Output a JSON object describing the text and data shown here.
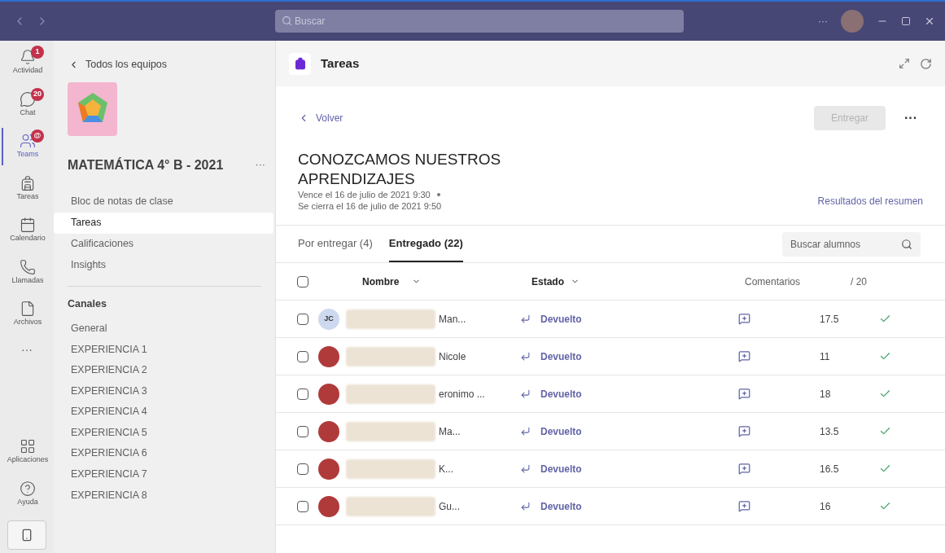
{
  "title_bar": {
    "search_placeholder": "Buscar",
    "more": "···"
  },
  "rail": [
    {
      "label": "Actividad",
      "kind": "bell",
      "badge": "1",
      "selected": false
    },
    {
      "label": "Chat",
      "kind": "chat",
      "badge": "20",
      "selected": false
    },
    {
      "label": "Teams",
      "kind": "teams",
      "badge": "@",
      "selected": true
    },
    {
      "label": "Tareas",
      "kind": "bag",
      "selected": false
    },
    {
      "label": "Calendario",
      "kind": "calendar",
      "selected": false
    },
    {
      "label": "Llamadas",
      "kind": "phone",
      "selected": false
    },
    {
      "label": "Archivos",
      "kind": "file",
      "selected": false
    }
  ],
  "rail_more": "···",
  "rail_bottom": [
    {
      "label": "Aplicaciones",
      "kind": "apps",
      "selected": false
    },
    {
      "label": "Ayuda",
      "kind": "help",
      "selected": false
    }
  ],
  "team_panel": {
    "back": "Todos los equipos",
    "team_name": "MATEMÁTICA 4° B - 2021",
    "more": "···",
    "nav": [
      {
        "label": "Bloc de notas de clase",
        "selected": false
      },
      {
        "label": "Tareas",
        "selected": true
      },
      {
        "label": "Calificaciones",
        "selected": false
      },
      {
        "label": "Insights",
        "selected": false
      }
    ],
    "channels_heading": "Canales",
    "channels": [
      "General",
      "EXPERIENCIA 1",
      "EXPERIENCIA 2",
      "EXPERIENCIA 3",
      "EXPERIENCIA 4",
      "EXPERIENCIA 5",
      "EXPERIENCIA 6",
      "EXPERIENCIA 7",
      "EXPERIENCIA 8"
    ]
  },
  "app_header": {
    "title": "Tareas"
  },
  "assignment": {
    "back": "Volver",
    "submit": {
      "label": "Entregar",
      "disabled": true
    },
    "more": "···",
    "title": "CONOZCAMOS NUESTROS APRENDIZAJES",
    "due": "Vence el 16 de julio de 2021 9:30",
    "closes": "Se cierra el 16 de julio de 2021 9:50",
    "summary_link": "Resultados del resumen"
  },
  "tabs": [
    {
      "label": "Por entregar (4)",
      "selected": false
    },
    {
      "label": "Entregado (22)",
      "selected": true
    }
  ],
  "student_search": {
    "placeholder": "Buscar alumnos"
  },
  "table": {
    "select_all_checked": false,
    "columns": [
      "Nombre",
      "Estado",
      "Comentarios",
      "/ 20"
    ],
    "rows": [
      {
        "initials": "JC",
        "name": "Man...",
        "status": "Devuelto",
        "grade": "17.5",
        "checked": false,
        "returned": true
      },
      {
        "name": "Nicole",
        "status": "Devuelto",
        "grade": "11",
        "checked": false,
        "returned": true
      },
      {
        "name": "eronimo ...",
        "status": "Devuelto",
        "grade": "18",
        "checked": false,
        "returned": true
      },
      {
        "name": "Ma...",
        "status": "Devuelto",
        "grade": "13.5",
        "checked": false,
        "returned": true
      },
      {
        "name": "K...",
        "status": "Devuelto",
        "grade": "16.5",
        "checked": false,
        "returned": true
      },
      {
        "name": "Gu...",
        "status": "Devuelto",
        "grade": "16",
        "checked": false,
        "returned": true
      }
    ]
  }
}
